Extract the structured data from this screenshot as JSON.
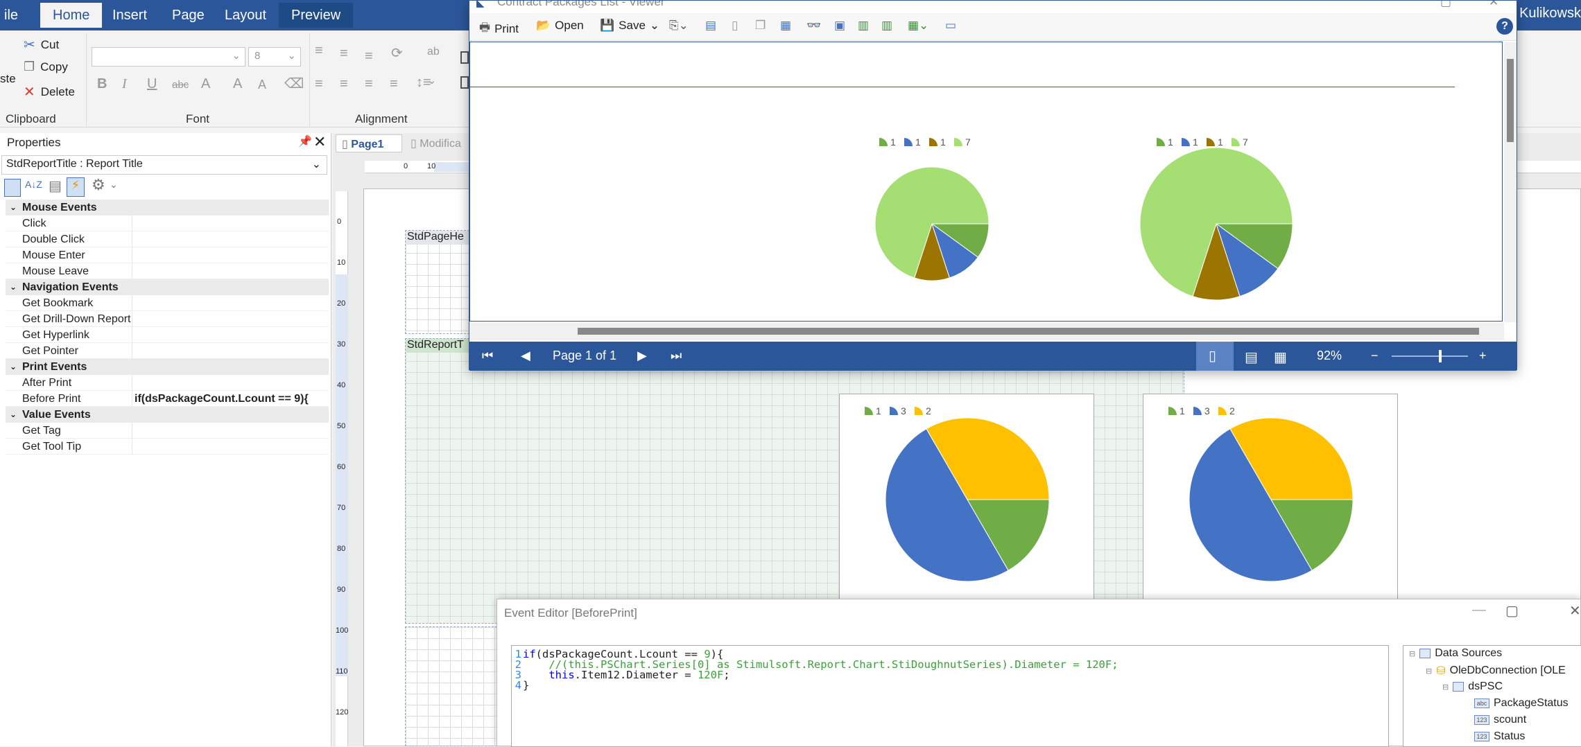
{
  "ribbon": {
    "tabs": [
      "ile",
      "Home",
      "Insert",
      "Page",
      "Layout",
      "Preview"
    ],
    "user": "n Kulikowsk",
    "clipboard": {
      "paste": "ste",
      "cut": "Cut",
      "copy": "Copy",
      "delete": "Delete",
      "label": "Clipboard"
    },
    "font": {
      "size": "8",
      "label": "Font"
    },
    "alignment": {
      "label": "Alignment"
    }
  },
  "properties": {
    "title": "Properties",
    "selected_object": "StdReportTitle : Report Title",
    "categories": [
      {
        "name": "Mouse  Events",
        "items": [
          {
            "name": "Click"
          },
          {
            "name": "Double Click"
          },
          {
            "name": "Mouse Enter"
          },
          {
            "name": "Mouse Leave"
          }
        ]
      },
      {
        "name": "Navigation  Events",
        "items": [
          {
            "name": "Get Bookmark"
          },
          {
            "name": "Get Drill-Down Report"
          },
          {
            "name": "Get Hyperlink"
          },
          {
            "name": "Get Pointer"
          }
        ]
      },
      {
        "name": "Print  Events",
        "items": [
          {
            "name": "After Print"
          },
          {
            "name": "Before Print",
            "value": "if(dsPackageCount.Lcount == 9){"
          }
        ]
      },
      {
        "name": "Value  Events",
        "items": [
          {
            "name": "Get Tag"
          },
          {
            "name": "Get Tool Tip"
          }
        ]
      }
    ]
  },
  "designer": {
    "page_tabs": [
      "Page1",
      "Modifica"
    ],
    "ruler_top": [
      "0",
      "10"
    ],
    "ruler_left": [
      "0",
      "10",
      "20",
      "30",
      "40",
      "50",
      "60",
      "70",
      "80",
      "90",
      "100",
      "110",
      "120"
    ],
    "bands": {
      "page_header": "StdPageHe",
      "report_title": "StdReportT"
    },
    "design_charts": [
      {
        "legend": [
          "1",
          "3",
          "2"
        ]
      },
      {
        "legend": [
          "1",
          "3",
          "2"
        ]
      }
    ]
  },
  "viewer": {
    "title": "Contract Packages List - Viewer",
    "toolbar": {
      "print": "Print",
      "open": "Open",
      "save": "Save"
    },
    "page_label": "Page 1 of 1",
    "zoom": "92%",
    "zoom_fraction": 0.62,
    "charts": [
      {
        "legend": [
          "1",
          "1",
          "1",
          "7"
        ]
      },
      {
        "legend": [
          "1",
          "1",
          "1",
          "7"
        ]
      }
    ]
  },
  "colors": {
    "green_dark": "#70ad47",
    "blue": "#4472c4",
    "brown": "#9c7500",
    "green_light": "#a5de72",
    "yellow": "#ffc000",
    "ribbon": "#2b579a"
  },
  "chart_data": [
    {
      "type": "pie",
      "series": [
        {
          "values": [
            1,
            1,
            1,
            7
          ]
        }
      ],
      "categories": [
        "1",
        "1",
        "1",
        "7"
      ],
      "colors": [
        "#70ad47",
        "#4472c4",
        "#9c7500",
        "#a5de72"
      ]
    },
    {
      "type": "pie",
      "series": [
        {
          "values": [
            1,
            1,
            1,
            7
          ]
        }
      ],
      "categories": [
        "1",
        "1",
        "1",
        "7"
      ],
      "colors": [
        "#70ad47",
        "#4472c4",
        "#9c7500",
        "#a5de72"
      ]
    },
    {
      "type": "pie",
      "series": [
        {
          "values": [
            1,
            3,
            2
          ]
        }
      ],
      "categories": [
        "1",
        "3",
        "2"
      ],
      "colors": [
        "#70ad47",
        "#4472c4",
        "#ffc000"
      ]
    },
    {
      "type": "pie",
      "series": [
        {
          "values": [
            1,
            3,
            2
          ]
        }
      ],
      "categories": [
        "1",
        "3",
        "2"
      ],
      "colors": [
        "#70ad47",
        "#4472c4",
        "#ffc000"
      ]
    }
  ],
  "editor": {
    "title": "Event Editor [BeforePrint]",
    "code_lines": [
      {
        "num": "1",
        "parts": [
          {
            "t": "kw",
            "s": "if"
          },
          {
            "t": "tx",
            "s": "(dsPackageCount.Lcount == "
          },
          {
            "t": "nm",
            "s": "9"
          },
          {
            "t": "tx",
            "s": "){"
          }
        ]
      },
      {
        "num": "2",
        "parts": [
          {
            "t": "tx",
            "s": "    "
          },
          {
            "t": "cm",
            "s": "//(this.PSChart.Series[0] as Stimulsoft.Report.Chart.StiDoughnutSeries).Diameter = 120F;"
          }
        ]
      },
      {
        "num": "3",
        "parts": [
          {
            "t": "tx",
            "s": "    "
          },
          {
            "t": "kw",
            "s": "this"
          },
          {
            "t": "tx",
            "s": ".Item12.Diameter = "
          },
          {
            "t": "nm",
            "s": "120F"
          },
          {
            "t": "tx",
            "s": ";"
          }
        ]
      },
      {
        "num": "4",
        "parts": [
          {
            "t": "tx",
            "s": "}"
          }
        ]
      }
    ],
    "tree": [
      "Data Sources",
      "OleDbConnection [OLE",
      "dsPSC",
      "PackageStatus",
      "scount",
      "Status"
    ],
    "tree_icons": [
      "abc",
      "123",
      "123"
    ]
  }
}
